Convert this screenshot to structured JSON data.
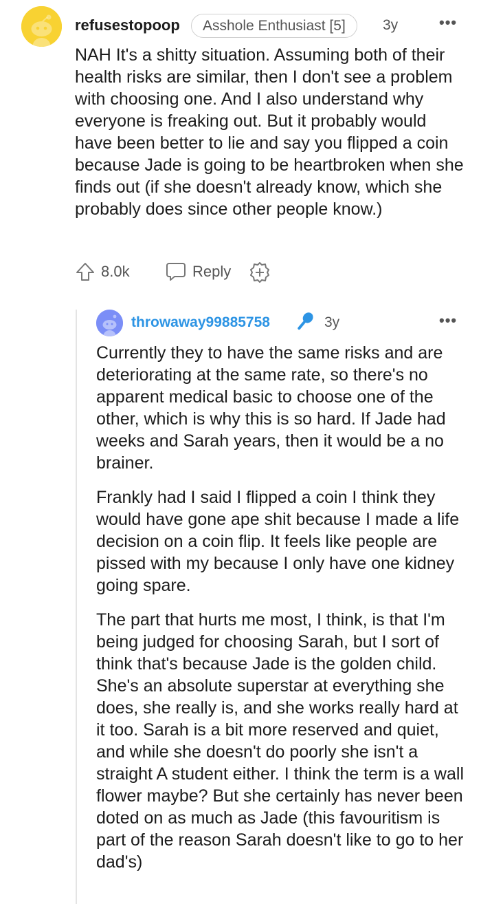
{
  "top_comment": {
    "username": "refusestopoop",
    "flair": "Asshole Enthusiast [5]",
    "age": "3y",
    "more_label": "•••",
    "body": "NAH It's a shitty situation. Assuming both of their health risks are similar, then I don't see a problem with choosing one. And I also understand why everyone is freaking out. But it probably would have been better to lie and say you flipped a coin because Jade is going to be heartbroken when she finds out (if she doesn't already know, which she probably does since other people know.)",
    "votes": "8.0k",
    "reply_label": "Reply",
    "icons": {
      "upvote": "upvote-arrow-icon",
      "reply": "speech-bubble-icon",
      "award": "award-plus-icon"
    }
  },
  "reply_comment": {
    "username": "throwaway99885758",
    "age": "3y",
    "more_label": "•••",
    "op_badge_icon": "microphone-icon",
    "paragraphs": [
      "Currently they to have the same risks and are deteriorating at the same rate, so there's no apparent medical basic to choose one of the other, which is why this is so hard. If Jade had weeks and Sarah years, then it would be a no brainer.",
      "Frankly had I said I flipped a coin I think they would have gone ape shit because I made a life decision on a coin flip. It feels like people are pissed with my because I only have one kidney going spare.",
      "The part that hurts me most, I think, is that I'm being judged for choosing Sarah, but I sort of think that's because Jade is the golden child. She's an absolute superstar at everything she does, she really is, and she works really hard at it too. Sarah is a bit more reserved and quiet, and while she doesn't do poorly she isn't a straight A student either. I think the term is a wall flower maybe? But she certainly has never been doted on as much as Jade (this favouritism is part of the reason Sarah doesn't like to go to her dad's)"
    ]
  },
  "colors": {
    "top_avatar_bg": "#f8d232",
    "reply_avatar_bg": "#7b8ef7",
    "reply_username": "#2d94e4",
    "text": "#1c1c1c",
    "muted": "#555555"
  }
}
